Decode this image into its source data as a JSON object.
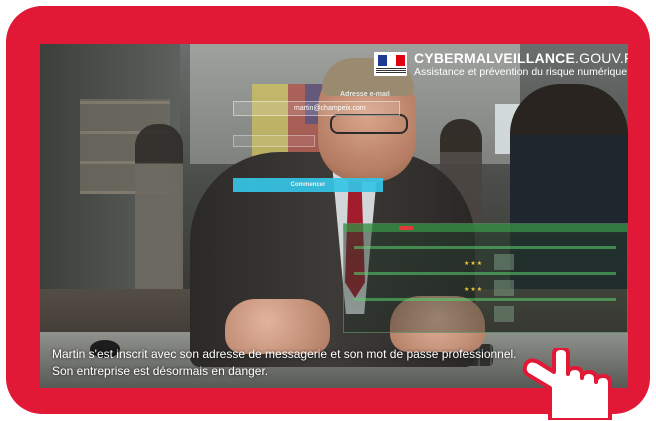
{
  "colors": {
    "frame": "#e11937",
    "button": "#35c5e6",
    "panel_accent": "#3cb450"
  },
  "logo": {
    "brand_main": "CYBERMALVEILLANCE",
    "brand_tld": ".GOUV.FR",
    "tagline": "Assistance et prévention du risque numérique"
  },
  "overlay_form": {
    "email_label": "Adresse e-mail",
    "email_value": "martin@champeix.com",
    "submit_label": "Commencer"
  },
  "subtitles": {
    "line1": "Martin s'est inscrit avec son adresse de messagerie et son mot de passe professionnel.",
    "line2": "Son entreprise est désormais en danger."
  },
  "icons": {
    "flag": "marianne-flag-icon",
    "cursor": "hand-pointer-icon"
  }
}
